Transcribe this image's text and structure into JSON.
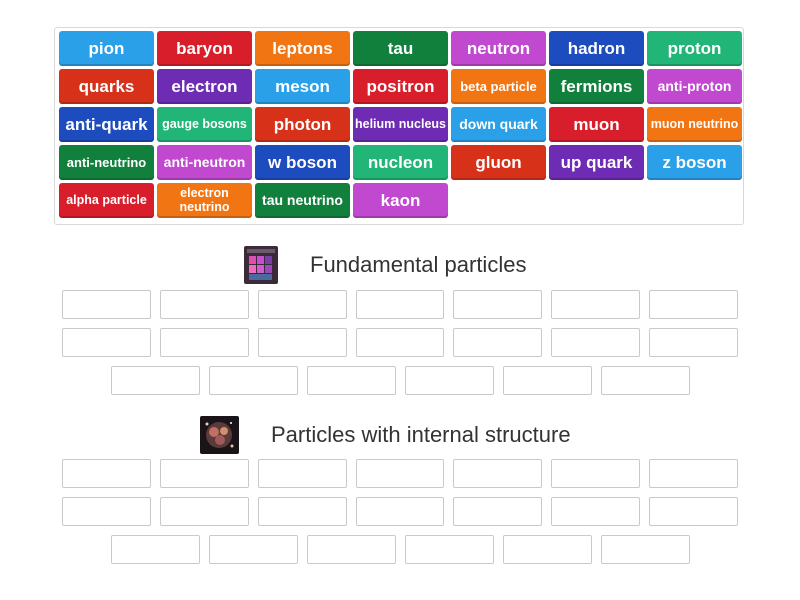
{
  "tiles": [
    {
      "label": "pion",
      "color": "#2aa0e8",
      "size": "l"
    },
    {
      "label": "baryon",
      "color": "#d91e2b",
      "size": "l"
    },
    {
      "label": "leptons",
      "color": "#f27513",
      "size": "l"
    },
    {
      "label": "tau",
      "color": "#12803d",
      "size": "l"
    },
    {
      "label": "neutron",
      "color": "#c149cf",
      "size": "l"
    },
    {
      "label": "hadron",
      "color": "#1d4cbf",
      "size": "l"
    },
    {
      "label": "proton",
      "color": "#21b577",
      "size": "l"
    },
    {
      "label": "quarks",
      "color": "#d8311a",
      "size": "l"
    },
    {
      "label": "electron",
      "color": "#6d2cb3",
      "size": "l"
    },
    {
      "label": "meson",
      "color": "#2aa0e8",
      "size": "l"
    },
    {
      "label": "positron",
      "color": "#d91e2b",
      "size": "l"
    },
    {
      "label": "beta particle",
      "color": "#f27513",
      "size": "s"
    },
    {
      "label": "fermions",
      "color": "#12803d",
      "size": "l"
    },
    {
      "label": "anti-proton",
      "color": "#c149cf",
      "size": "m"
    },
    {
      "label": "anti-quark",
      "color": "#1d4cbf",
      "size": "l"
    },
    {
      "label": "gauge bosons",
      "color": "#21b577",
      "size": "xs"
    },
    {
      "label": "photon",
      "color": "#d8311a",
      "size": "l"
    },
    {
      "label": "helium nucleus",
      "color": "#6d2cb3",
      "size": "xs"
    },
    {
      "label": "down quark",
      "color": "#2aa0e8",
      "size": "m"
    },
    {
      "label": "muon",
      "color": "#d91e2b",
      "size": "l"
    },
    {
      "label": "muon neutrino",
      "color": "#f27513",
      "size": "xs"
    },
    {
      "label": "anti-neutrino",
      "color": "#12803d",
      "size": "s"
    },
    {
      "label": "anti-neutron",
      "color": "#c149cf",
      "size": "m"
    },
    {
      "label": "w boson",
      "color": "#1d4cbf",
      "size": "l"
    },
    {
      "label": "nucleon",
      "color": "#21b577",
      "size": "l"
    },
    {
      "label": "gluon",
      "color": "#d8311a",
      "size": "l"
    },
    {
      "label": "up quark",
      "color": "#6d2cb3",
      "size": "l"
    },
    {
      "label": "z boson",
      "color": "#2aa0e8",
      "size": "l"
    },
    {
      "label": "alpha particle",
      "color": "#d91e2b",
      "size": "xs"
    },
    {
      "label": "electron neutrino",
      "color": "#f27513",
      "size": "xs"
    },
    {
      "label": "tau neutrino",
      "color": "#12803d",
      "size": "m"
    },
    {
      "label": "kaon",
      "color": "#c149cf",
      "size": "l"
    }
  ],
  "groups": [
    {
      "title": "Fundamental particles",
      "slot_rows": [
        7,
        7,
        6
      ]
    },
    {
      "title": "Particles with internal structure",
      "slot_rows": [
        7,
        7,
        6
      ]
    }
  ]
}
